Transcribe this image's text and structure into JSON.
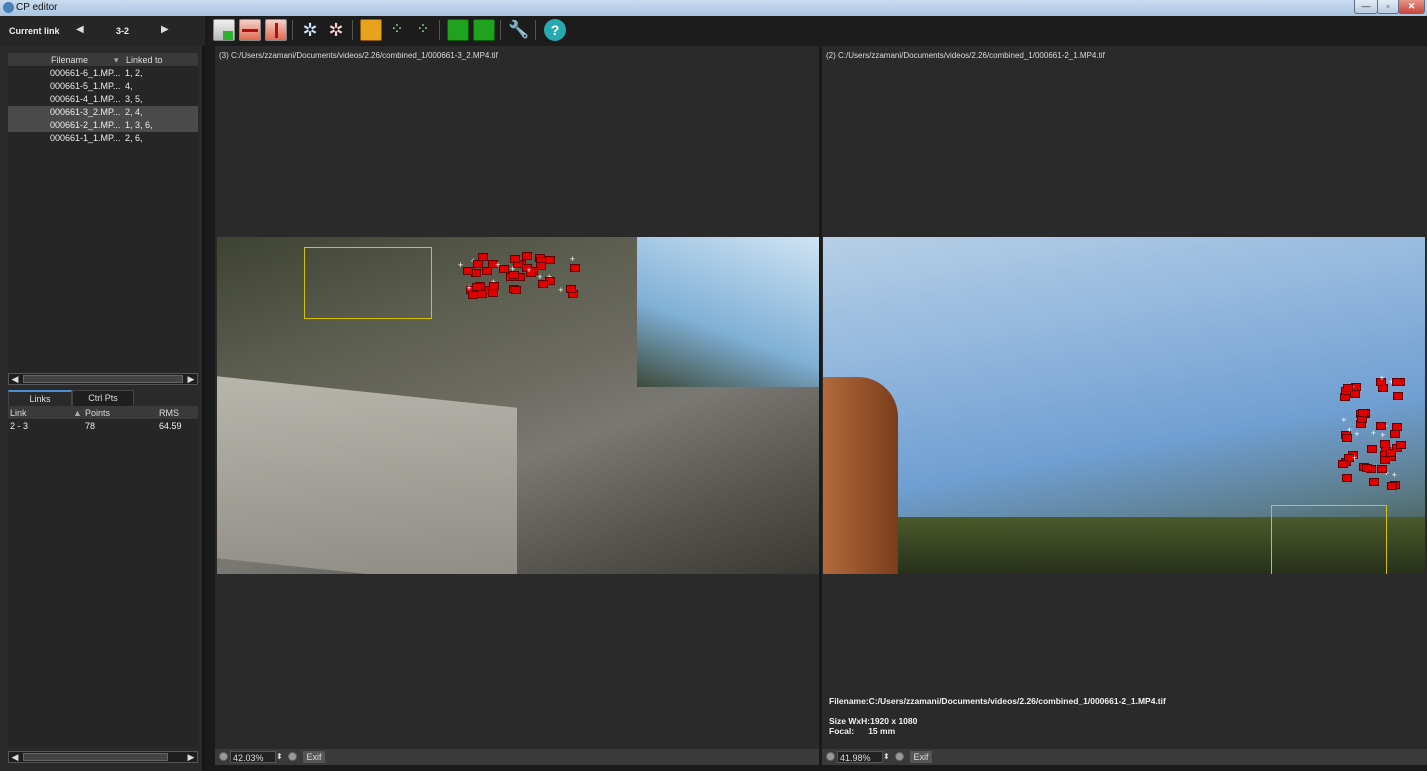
{
  "window": {
    "title": "CP editor",
    "minimize": "—",
    "restore": "▫",
    "close": "✕"
  },
  "current_link": {
    "label": "Current link",
    "value": "3-2",
    "prev_icon": "◀",
    "next_icon": "▶"
  },
  "images_table": {
    "headers": [
      "Filename",
      "Linked to"
    ],
    "rows": [
      {
        "filename": "000661-6_1.MP...",
        "linked": "1, 2,"
      },
      {
        "filename": "000661-5_1.MP...",
        "linked": "4,"
      },
      {
        "filename": "000661-4_1.MP...",
        "linked": "3, 5,"
      },
      {
        "filename": "000661-3_2.MP...",
        "linked": "2, 4,"
      },
      {
        "filename": "000661-2_1.MP...",
        "linked": "1, 3, 6,"
      },
      {
        "filename": "000661-1_1.MP...",
        "linked": "2, 6,"
      }
    ]
  },
  "tabs": {
    "links": "Links",
    "ctrl_pts": "Ctrl Pts"
  },
  "links_table": {
    "headers": [
      "Link",
      "Points",
      "RMS"
    ],
    "rows": [
      {
        "link": "2 - 3",
        "points": "78",
        "rms": "64.59"
      }
    ]
  },
  "left_image": {
    "title": "(3) C:/Users/zzamani/Documents/videos/2.26/combined_1/000661-3_2.MP4.tif",
    "zoom": "42.03%",
    "exif": "Exif"
  },
  "right_image": {
    "title": "(2) C:/Users/zzamani/Documents/videos/2.26/combined_1/000661-2_1.MP4.tif",
    "zoom": "41.98%",
    "exif": "Exif",
    "info_filename": "Filename:C:/Users/zzamani/Documents/videos/2.26/combined_1/000661-2_1.MP4.tif",
    "info_size": "Size WxH:1920 x 1080",
    "info_focal": "Focal:      15 mm"
  },
  "colors": {
    "accent": "#4a90d9",
    "control_point": "#e00000",
    "selection_box": "#d4c200"
  }
}
